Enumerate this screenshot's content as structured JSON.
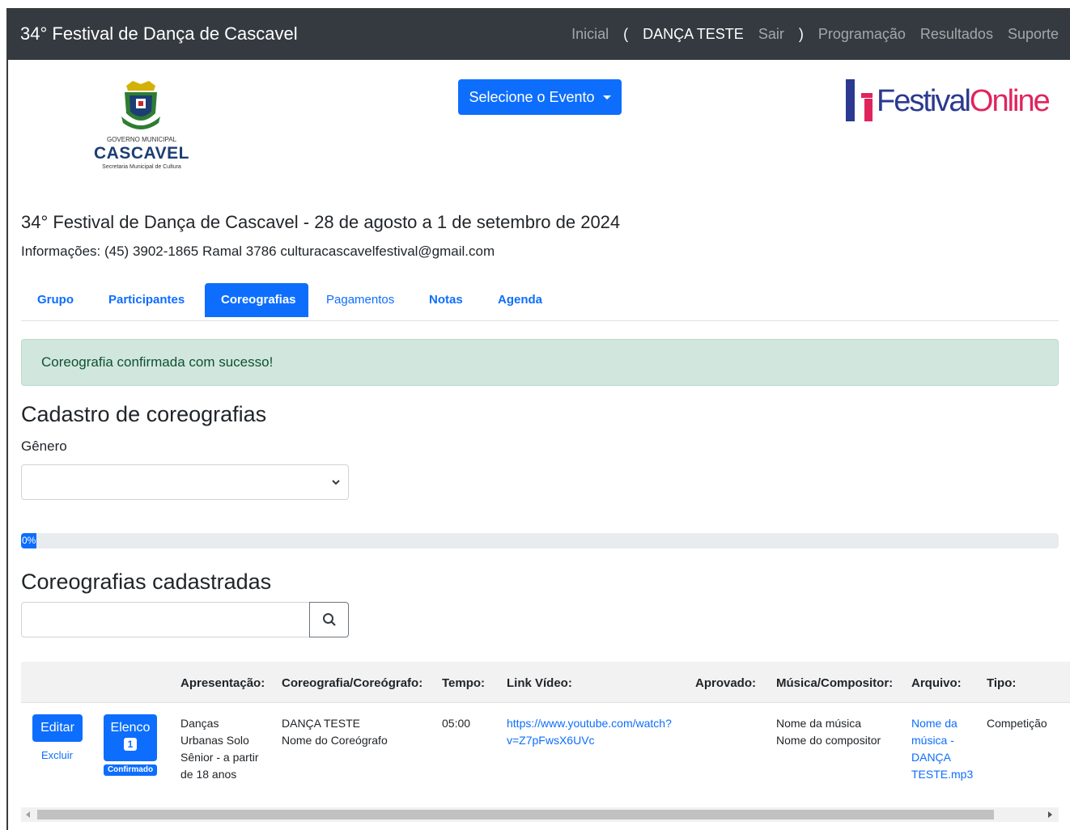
{
  "navbar": {
    "brand": "34° Festival de Dança de Cascavel",
    "links": {
      "home": "Inicial",
      "paren_open": "(",
      "user": "DANÇA TESTE",
      "logout": "Sair",
      "paren_close": ")",
      "schedule": "Programação",
      "results": "Resultados",
      "support": "Suporte"
    }
  },
  "logos": {
    "left": {
      "gov": "GOVERNO MUNICIPAL",
      "city": "CASCAVEL",
      "secretaria": "Secretaria Municipal de Cultura"
    },
    "right": {
      "part1": "Festival",
      "part2": "Online"
    }
  },
  "event_select": {
    "label": "Selecione o Evento"
  },
  "event": {
    "title": "34° Festival de Dança de Cascavel - 28 de agosto a 1 de setembro de 2024",
    "info": "Informações: (45) 3902-1865 Ramal 3786 culturacascavelfestival@gmail.com"
  },
  "tabs": [
    "Grupo",
    "Participantes",
    "Coreografias",
    "Pagamentos",
    "Notas",
    "Agenda"
  ],
  "alert": {
    "text": "Coreografia confirmada com sucesso!"
  },
  "cadastro": {
    "title": "Cadastro de coreografias",
    "genero_label": "Gênero",
    "genero_value": ""
  },
  "progress": {
    "percent": 0,
    "label": "0%"
  },
  "cadastradas": {
    "title": "Coreografias cadastradas",
    "search_value": ""
  },
  "table": {
    "headers": [
      "Apresentação:",
      "Coreografia/Coreógrafo:",
      "Tempo:",
      "Link Vídeo:",
      "Aprovado:",
      "Música/Compositor:",
      "Arquivo:",
      "Tipo:"
    ],
    "row": {
      "edit": "Editar",
      "delete": "Excluir",
      "elenco": "Elenco",
      "elenco_count": "1",
      "status": "Confirmado",
      "apresentacao": [
        "Danças",
        "Urbanas Solo",
        "Sênior - a partir",
        "de 18 anos"
      ],
      "coreografia": "DANÇA TESTE",
      "coreografo": "Nome do Coreógrafo",
      "tempo": "05:00",
      "video": [
        "https://www.youtube.com/watch?",
        "v=Z7pFwsX6UVc"
      ],
      "aprovado": "",
      "musica": "Nome da música",
      "compositor": "Nome do compositor",
      "arquivo": [
        "Nome da",
        "música -",
        "DANÇA",
        "TESTE.mp3"
      ],
      "tipo": "Competição"
    }
  },
  "colors": {
    "primary": "#0d6efd",
    "navbar": "#343a40",
    "alert_bg": "#d1e7dd",
    "alert_text": "#0f5132"
  }
}
